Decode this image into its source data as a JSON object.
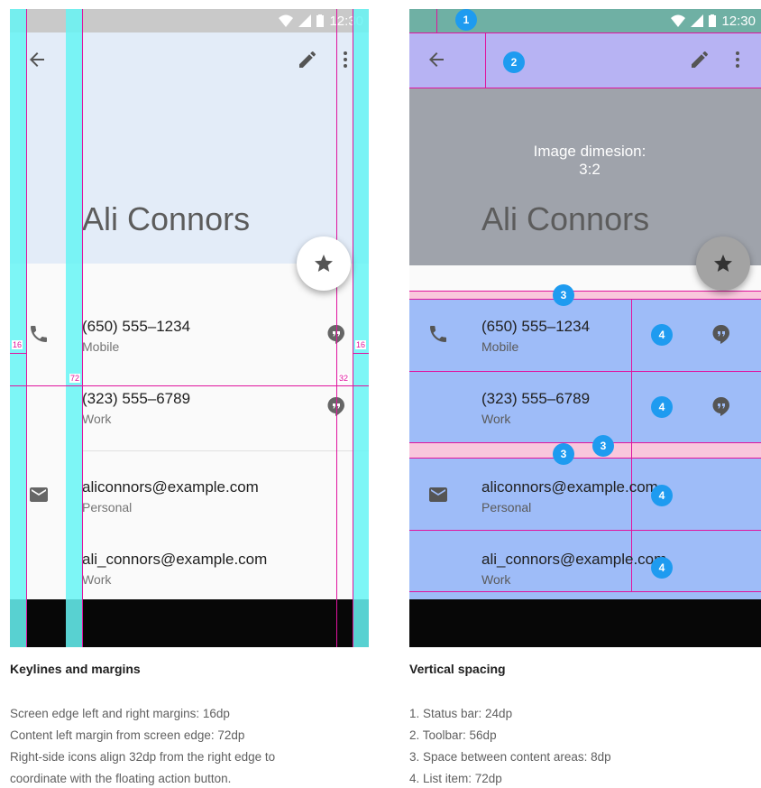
{
  "contact": {
    "name": "Ali Connors",
    "status_time": "12:30",
    "entries": [
      {
        "primary": "(650) 555–1234",
        "secondary": "Mobile",
        "lead_icon": "phone-icon",
        "trail_icon": "hangouts-icon"
      },
      {
        "primary": "(323) 555–6789",
        "secondary": "Work",
        "lead_icon": "",
        "trail_icon": "hangouts-icon"
      },
      {
        "primary": "aliconnors@example.com",
        "secondary": "Personal",
        "lead_icon": "email-icon",
        "trail_icon": ""
      },
      {
        "primary": "ali_connors@example.com",
        "secondary": "Work",
        "lead_icon": "",
        "trail_icon": ""
      }
    ]
  },
  "left": {
    "title": "Keylines and margins",
    "lines": [
      "Screen edge left and right margins: 16dp",
      "Content left margin from screen edge: 72dp",
      "Right-side icons align 32dp from the right edge to",
      "coordinate with the floating action button."
    ],
    "dims": {
      "margin_left": "16",
      "margin_right": "16",
      "content_left": "72",
      "icons_right": "32"
    }
  },
  "right": {
    "title": "Vertical spacing",
    "image_note": "Image dimesion:",
    "image_ratio": "3:2",
    "lines": [
      "1. Status bar: 24dp",
      "2. Toolbar: 56dp",
      "3. Space between content areas: 8dp",
      "4. List item: 72dp"
    ],
    "badges": [
      "1",
      "2",
      "3",
      "4"
    ]
  },
  "colors": {
    "header_left": "#e3ecf8",
    "header_right": "#9fa3ab",
    "keyline_fill": "#7ff5f5",
    "keyline_stroke": "#e0149e",
    "statusbar_right": "#6fb0a4",
    "toolbar_right": "#b7b3f3",
    "spacing_pink": "#f9c7dc",
    "list_blue": "#9ebcf8",
    "badge": "#1e9bf0"
  }
}
